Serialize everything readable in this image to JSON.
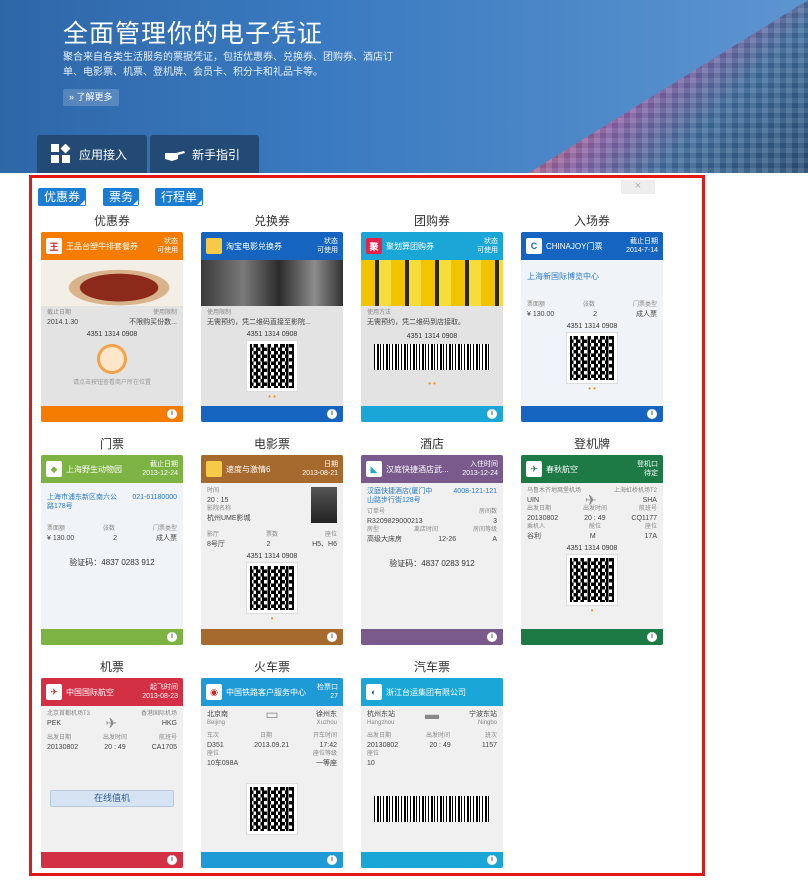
{
  "hero": {
    "title": "全面管理你的电子凭证",
    "desc": "聚合来自各类生活服务的票据凭证，包括优惠券、兑换券、团购券、酒店订单、电影票、机票、登机牌、会员卡、积分卡和礼品卡等。",
    "learn_more": "» 了解更多",
    "tabs": [
      "应用接入",
      "新手指引"
    ]
  },
  "chips": [
    "优惠券",
    "票务",
    "行程单"
  ],
  "close": "×",
  "colors": {
    "orange": "#f57c00",
    "blue": "#1565c0",
    "cyan": "#1aa7d8",
    "green": "#7cb342",
    "brown": "#a66a2e",
    "purple": "#7a5a8c",
    "darkgreen": "#1d7a45",
    "red": "#d32f45",
    "sky": "#1e9ad6"
  },
  "cards": [
    {
      "title": "优惠券",
      "head": "王品台塑牛排套餐券",
      "right": "状态\n可使用",
      "f1_l": "截止日期",
      "f1": "2014.1.30",
      "f2_l": "使用限制",
      "f2": "不限购买份数...",
      "code": "4351 1314 0908",
      "hint": "请点击按钮查看商户所在位置"
    },
    {
      "title": "兑换券",
      "head": "淘宝电影兑换券",
      "right": "状态\n可使用",
      "f1_l": "使用限制",
      "f1": "无需预约，凭二维码直接至影院...",
      "code": "4351 1314 0908"
    },
    {
      "title": "团购券",
      "head": "聚划算团购券",
      "right": "状态\n可使用",
      "f1_l": "使用方法",
      "f1": "无需预约，凭二维码到店接取。",
      "code": "4351 1314 0908"
    },
    {
      "title": "入场券",
      "head": "CHINAJOY门票",
      "right": "截止日期\n2014-7-14",
      "venue": "上海新国际博览中心",
      "f1_l": "票面额",
      "f1": "¥ 130.00",
      "f2_l": "张数",
      "f2": "2",
      "f3_l": "门票类型",
      "f3": "成人票",
      "code": "4351 1314 0908"
    },
    {
      "title": "门票",
      "head": "上海野生动物园",
      "right": "截止日期\n2013-12-24",
      "addr": "上海市浦东新区南六公路178号",
      "phone": "021-61180000",
      "f1_l": "票面额",
      "f1": "¥ 130.00",
      "f2_l": "张数",
      "f2": "2",
      "f3_l": "门票类型",
      "f3": "成人票",
      "verify": "验证码：4837 0283 912"
    },
    {
      "title": "电影票",
      "head": "速度与激情6",
      "right": "日期\n2013-08-21",
      "time_l": "时间",
      "time": "20 : 15",
      "cinema_l": "影院名称",
      "cinema": "杭州UME影城",
      "f1_l": "影厅",
      "f1": "8号厅",
      "f2_l": "票数",
      "f2": "2",
      "f3_l": "座位",
      "f3": "H5、H6",
      "code": "4351 1314 0908"
    },
    {
      "title": "酒店",
      "head": "汉庭快捷酒店武...",
      "right": "入住时间\n2013-12-24",
      "addr": "汉庭快捷酒店(厦门中山路步行街128号",
      "phone": "4008-121-121",
      "order_l": "订单号",
      "order": "R3209829000213",
      "rooms_l": "房间数",
      "rooms": "3",
      "f1_l": "房型",
      "f1": "高级大床房",
      "f2_l": "离店时间",
      "f2": "12-26",
      "f3_l": "房间等级",
      "f3": "A",
      "verify": "验证码：4837 0283 912"
    },
    {
      "title": "登机牌",
      "head": "春秋航空",
      "right": "登机口\n待定",
      "from_l": "乌鲁木齐地窝堡机场",
      "from": "UIN",
      "to_l": "上海虹桥机场T2",
      "to": "SHA",
      "d_l": "出发日期",
      "d": "20130802",
      "t_l": "出发时间",
      "t": "20 : 49",
      "n_l": "航班号",
      "n": "CQ1177",
      "p_l": "乘机人",
      "p": "谷利",
      "c_l": "舱位",
      "c": "M",
      "s_l": "座位",
      "s": "17A",
      "code": "4351 1314 0908"
    },
    {
      "title": "机票",
      "head": "中国国际航空",
      "right": "起飞时间\n2013-08-23",
      "from_l": "北京首都机场T3",
      "from": "PEK",
      "to_l": "香港国际机场",
      "to": "HKG",
      "d_l": "出发日期",
      "d": "20130802",
      "t_l": "出发时间",
      "t": "20 : 49",
      "n_l": "航班号",
      "n": "CA1705",
      "btn": "在线值机"
    },
    {
      "title": "火车票",
      "head": "中国铁路客户服务中心",
      "right": "检票口\n27",
      "from": "北京南",
      "from_en": "Beijing",
      "to": "徐州东",
      "to_en": "Xuzhou",
      "n_l": "车次",
      "n": "D351",
      "d_l": "日期",
      "d": "2013.09.21",
      "t_l": "开车时间",
      "t": "17:42",
      "s_l": "座位",
      "s": "10车098A",
      "c_l": "座位等级",
      "c": "一等座"
    },
    {
      "title": "汽车票",
      "head": "浙江台运集团有限公司",
      "from": "杭州东站",
      "from_en": "Hangzhou",
      "to": "宁波东站",
      "to_en": "Ningbo",
      "d_l": "出发日期",
      "d": "20130802",
      "t_l": "出发时间",
      "t": "20 : 49",
      "n_l": "班次",
      "n": "1157",
      "s_l": "座位",
      "s": "10"
    }
  ]
}
